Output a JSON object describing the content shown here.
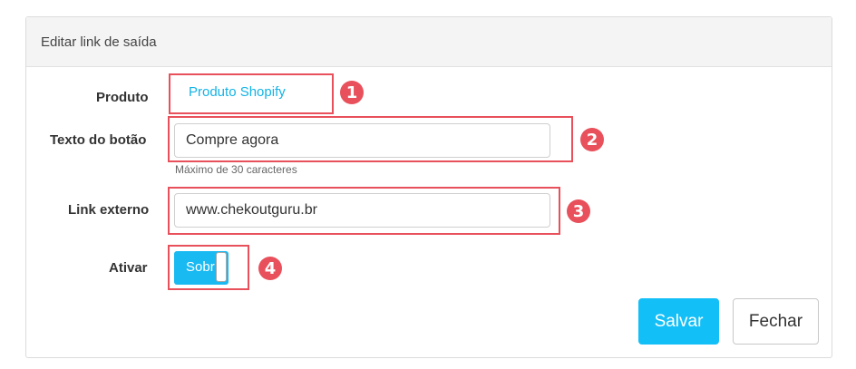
{
  "modal": {
    "title": "Editar link de saída"
  },
  "form": {
    "product": {
      "label": "Produto",
      "value": "Produto Shopify"
    },
    "button_text": {
      "label": "Texto do botão",
      "value": "Compre agora",
      "hint": "Máximo de 30 caracteres"
    },
    "external_link": {
      "label": "Link externo",
      "value": "www.chekoutguru.br"
    },
    "activate": {
      "label": "Ativar",
      "toggle_text": "Sobr",
      "checked": true
    }
  },
  "annotations": [
    "1",
    "2",
    "3",
    "4"
  ],
  "actions": {
    "save_label": "Salvar",
    "close_label": "Fechar"
  },
  "colors": {
    "accent": "#13bff7",
    "annotation": "#e8505b",
    "link": "#13b3e6",
    "header_bg": "#f4f4f4"
  }
}
